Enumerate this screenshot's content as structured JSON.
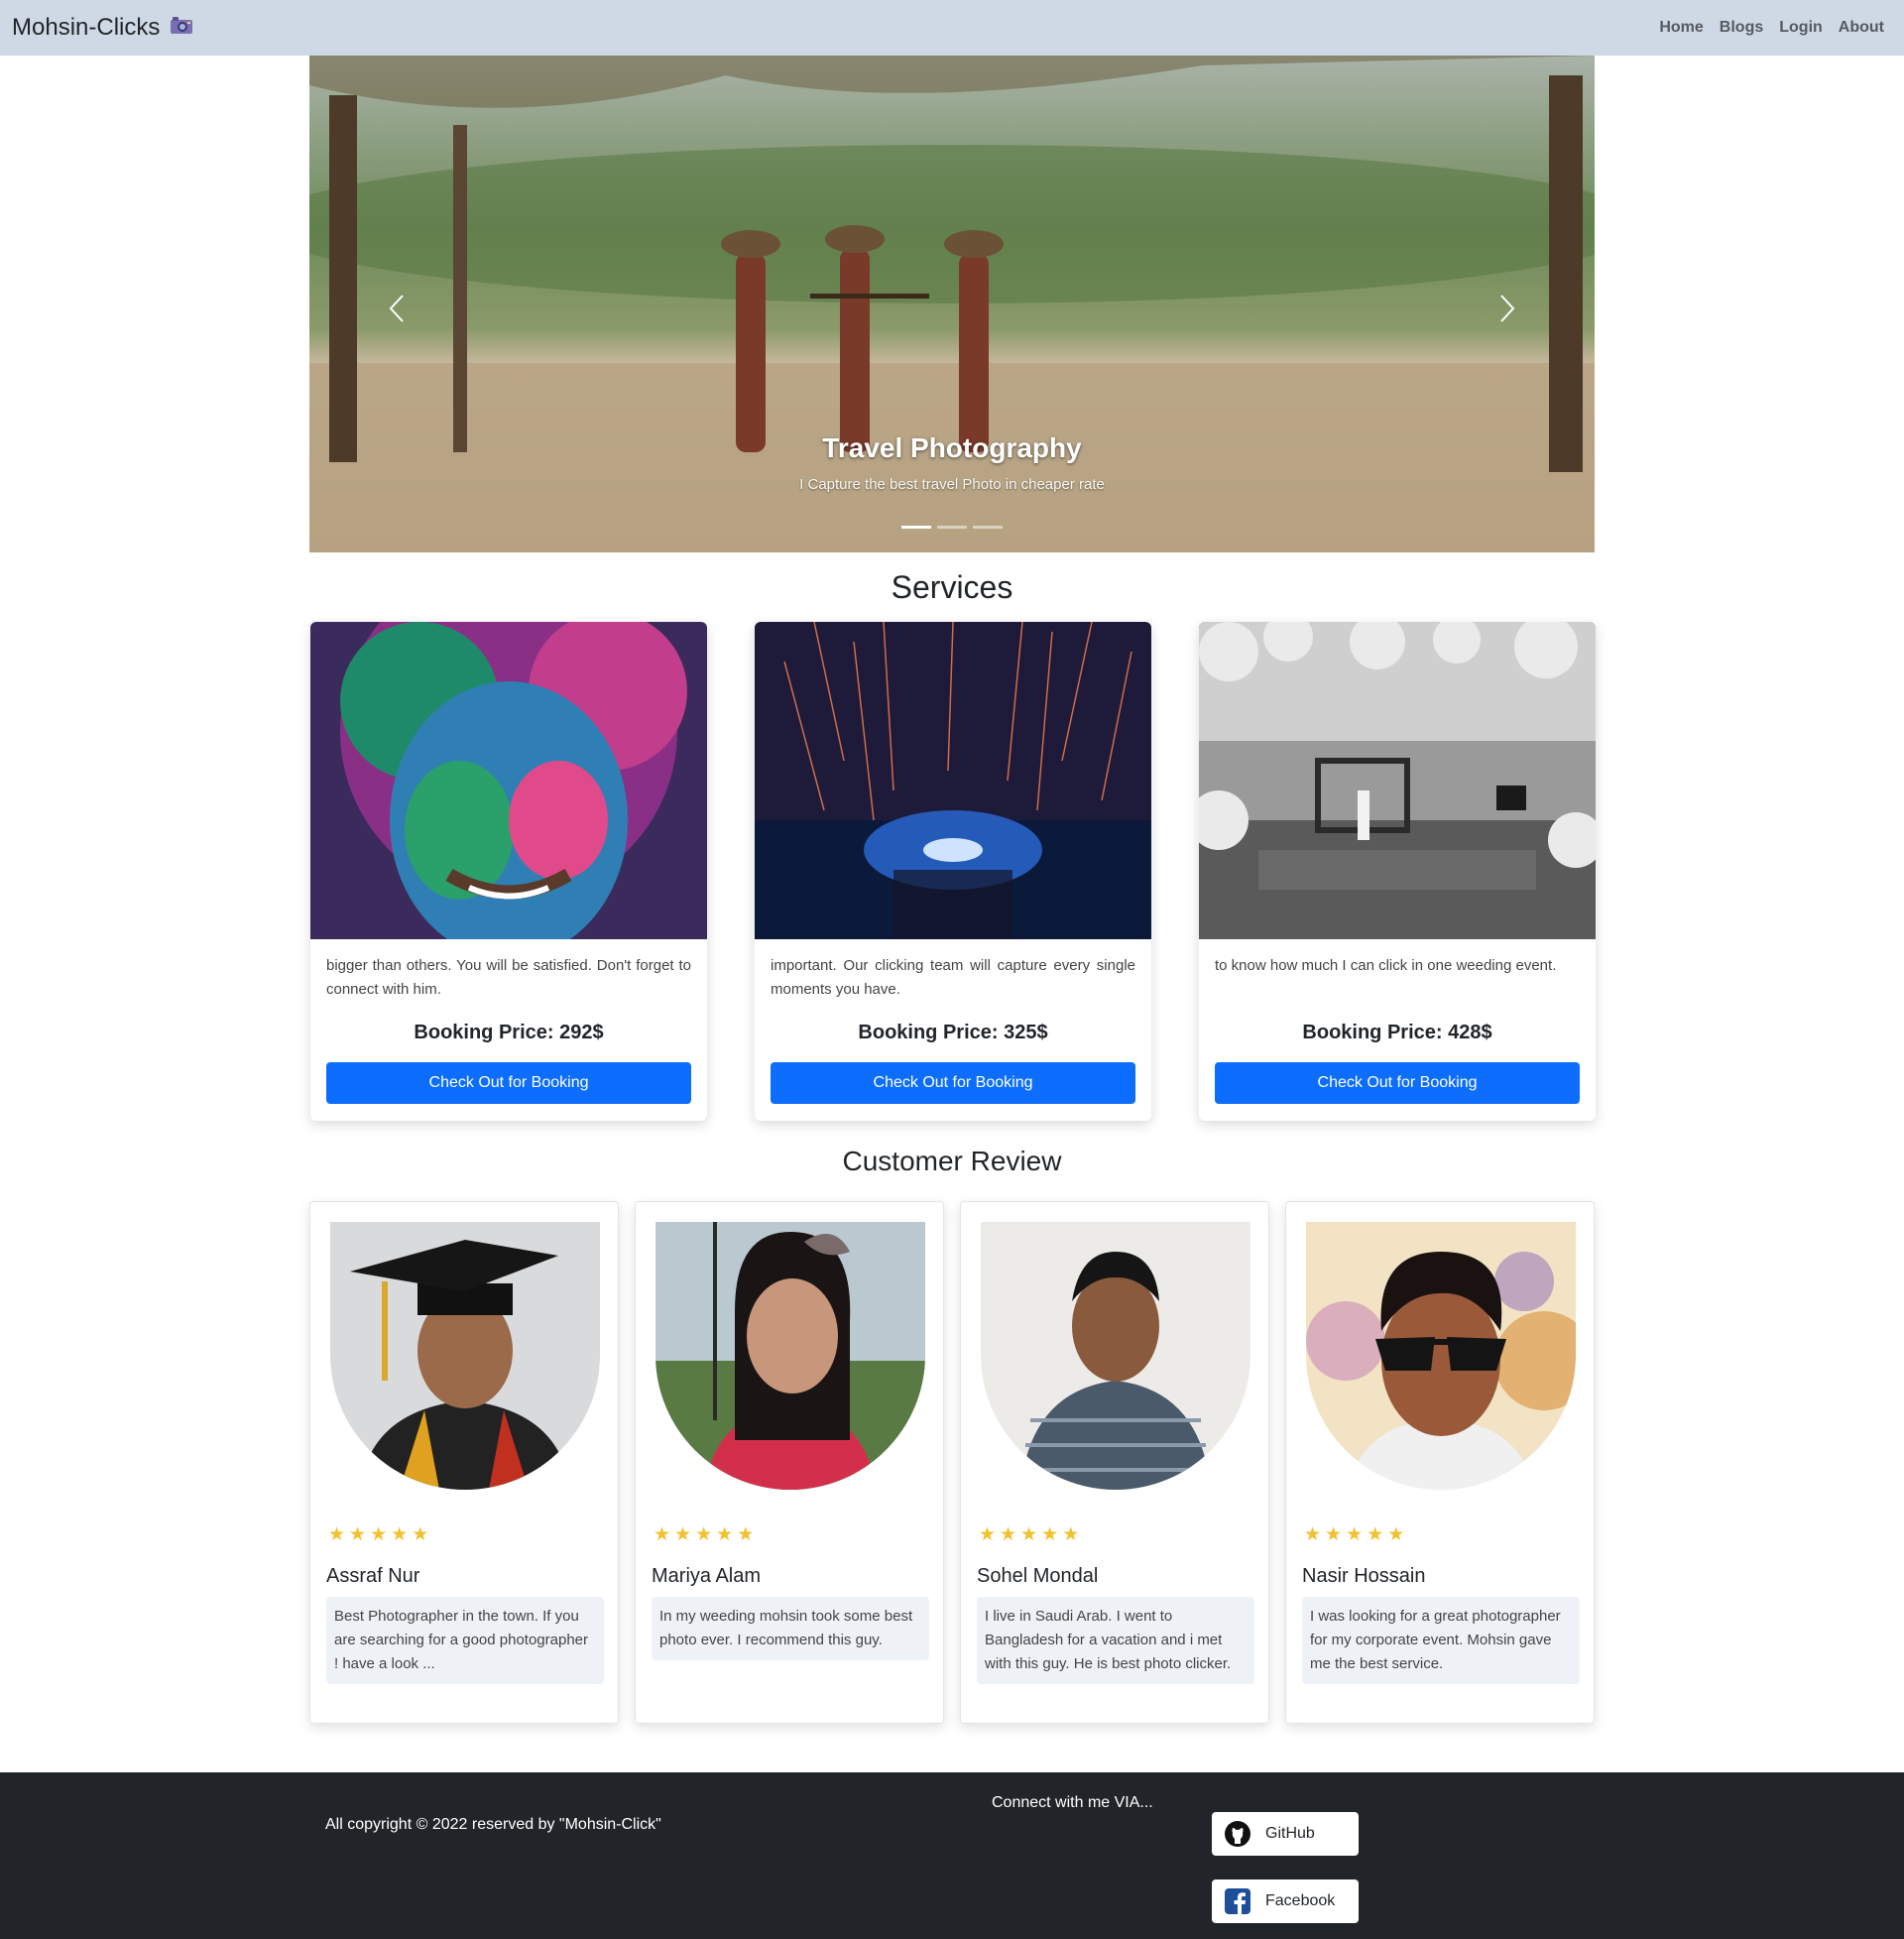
{
  "navbar": {
    "brand": "Mohsin-Clicks",
    "brand_icon": "camera-icon",
    "links": [
      "Home",
      "Blogs",
      "Login",
      "About"
    ]
  },
  "carousel": {
    "caption_title": "Travel Photography",
    "caption_text": "I Capture the best travel Photo in cheaper rate",
    "slide_count": 3,
    "active_slide": 1
  },
  "services": {
    "title": "Services",
    "items": [
      {
        "desc": "bigger than others. You will be satisfied. Don't forget to connect with him.",
        "price": "Booking Price: 292$",
        "button": "Check Out for Booking"
      },
      {
        "desc": "important. Our clicking team will capture every single moments you have.",
        "price": "Booking Price: 325$",
        "button": "Check Out for Booking"
      },
      {
        "desc": "to know how much I can click in one weeding event.",
        "price": "Booking Price: 428$",
        "button": "Check Out for Booking"
      }
    ]
  },
  "reviews": {
    "title": "Customer Review",
    "items": [
      {
        "name": "Assraf Nur",
        "rating": 5,
        "text": "Best Photographer in the town. If you are searching for a good photographer ! have a look ..."
      },
      {
        "name": "Mariya Alam",
        "rating": 5,
        "text": "In my weeding mohsin took some best photo ever. I recommend this guy."
      },
      {
        "name": "Sohel Mondal",
        "rating": 5,
        "text": "I live in Saudi Arab. I went to Bangladesh for a vacation and i met with this guy. He is best photo clicker."
      },
      {
        "name": "Nasir Hossain",
        "rating": 5,
        "text": "I was looking for a great photographer for my corporate event. Mohsin gave me the best service."
      }
    ]
  },
  "footer": {
    "copyright": "All copyright © 2022 reserved by \"Mohsin-Click\"",
    "connect": "Connect with me VIA...",
    "github": "GitHub",
    "facebook": "Facebook"
  },
  "colors": {
    "navbar_bg": "#cfd9e6",
    "primary_button": "#0d6efd",
    "star": "#f2c12e",
    "footer_bg": "#212529"
  }
}
